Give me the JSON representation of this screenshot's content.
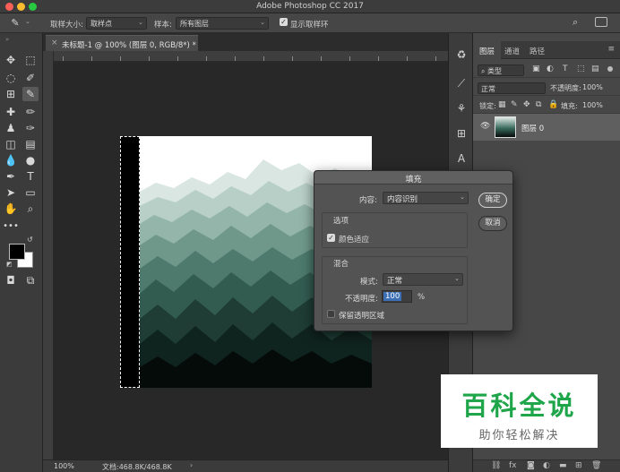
{
  "app": {
    "title": "Adobe Photoshop CC 2017"
  },
  "options_bar": {
    "sample_size_label": "取样大小:",
    "sample_size_value": "取样点",
    "sample_label": "样本:",
    "sample_value": "所有图层",
    "show_ring_label": "显示取样环",
    "show_ring_checked": true
  },
  "document": {
    "tab_title": "未标题-1 @ 100% (图层 0, RGB/8*) *"
  },
  "status_bar": {
    "zoom": "100%",
    "doc_info": "文档:468.8K/468.8K"
  },
  "layers_panel": {
    "tabs": [
      "图层",
      "通道",
      "路径"
    ],
    "kind_filter": "类型",
    "blend_mode": "正常",
    "opacity_label": "不透明度:",
    "opacity_value": "100%",
    "lock_label": "锁定:",
    "fill_label": "填充:",
    "fill_value": "100%",
    "layers": [
      {
        "name": "图层 0",
        "visible": true
      }
    ]
  },
  "fill_dialog": {
    "title": "填充",
    "content_label": "内容:",
    "content_value": "内容识别",
    "options_heading": "选项",
    "color_adapt_label": "颜色适应",
    "color_adapt_checked": true,
    "blend_heading": "混合",
    "mode_label": "模式:",
    "mode_value": "正常",
    "opacity_label": "不透明度:",
    "opacity_value": "100",
    "opacity_unit": "%",
    "preserve_transparency_label": "保留透明区域",
    "preserve_transparency_checked": false,
    "ok_label": "确定",
    "cancel_label": "取消"
  },
  "watermark": {
    "main": "百科全说",
    "sub": "助你轻松解决"
  },
  "colors": {
    "foreground": "#000000",
    "background": "#ffffff",
    "watermark_green": "#1fa64a"
  }
}
